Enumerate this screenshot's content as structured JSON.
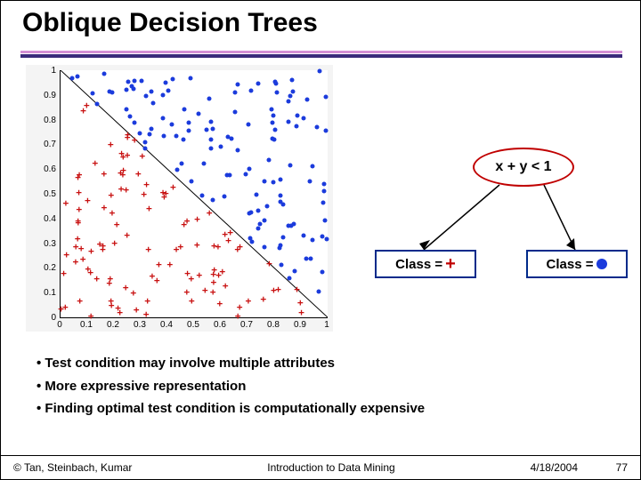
{
  "title": "Oblique Decision Trees",
  "chart_data": {
    "type": "scatter",
    "xlim": [
      0,
      1
    ],
    "ylim": [
      0,
      1
    ],
    "x_ticks": [
      0,
      0.1,
      0.2,
      0.3,
      0.4,
      0.5,
      0.6,
      0.7,
      0.8,
      0.9,
      1
    ],
    "y_ticks": [
      0,
      0.1,
      0.2,
      0.3,
      0.4,
      0.5,
      0.6,
      0.7,
      0.8,
      0.9,
      1
    ],
    "boundary": "x + y = 1",
    "series": [
      {
        "name": "plus",
        "marker": "+",
        "color": "#c81010",
        "region": "x + y < 1"
      },
      {
        "name": "dot",
        "marker": "circle",
        "color": "#1b3bdc",
        "region": "x + y >= 1"
      }
    ]
  },
  "tree": {
    "root_condition": "x + y < 1",
    "left_label_prefix": "Class =",
    "left_symbol": "+",
    "right_label_prefix": "Class =",
    "right_symbol": "dot"
  },
  "bullets": [
    "Test condition may involve multiple attributes",
    "More expressive representation",
    "Finding optimal test condition is computationally expensive"
  ],
  "footer": {
    "copyright": "© Tan, Steinbach, Kumar",
    "center": "Introduction to Data Mining",
    "date": "4/18/2004",
    "page": "77"
  }
}
